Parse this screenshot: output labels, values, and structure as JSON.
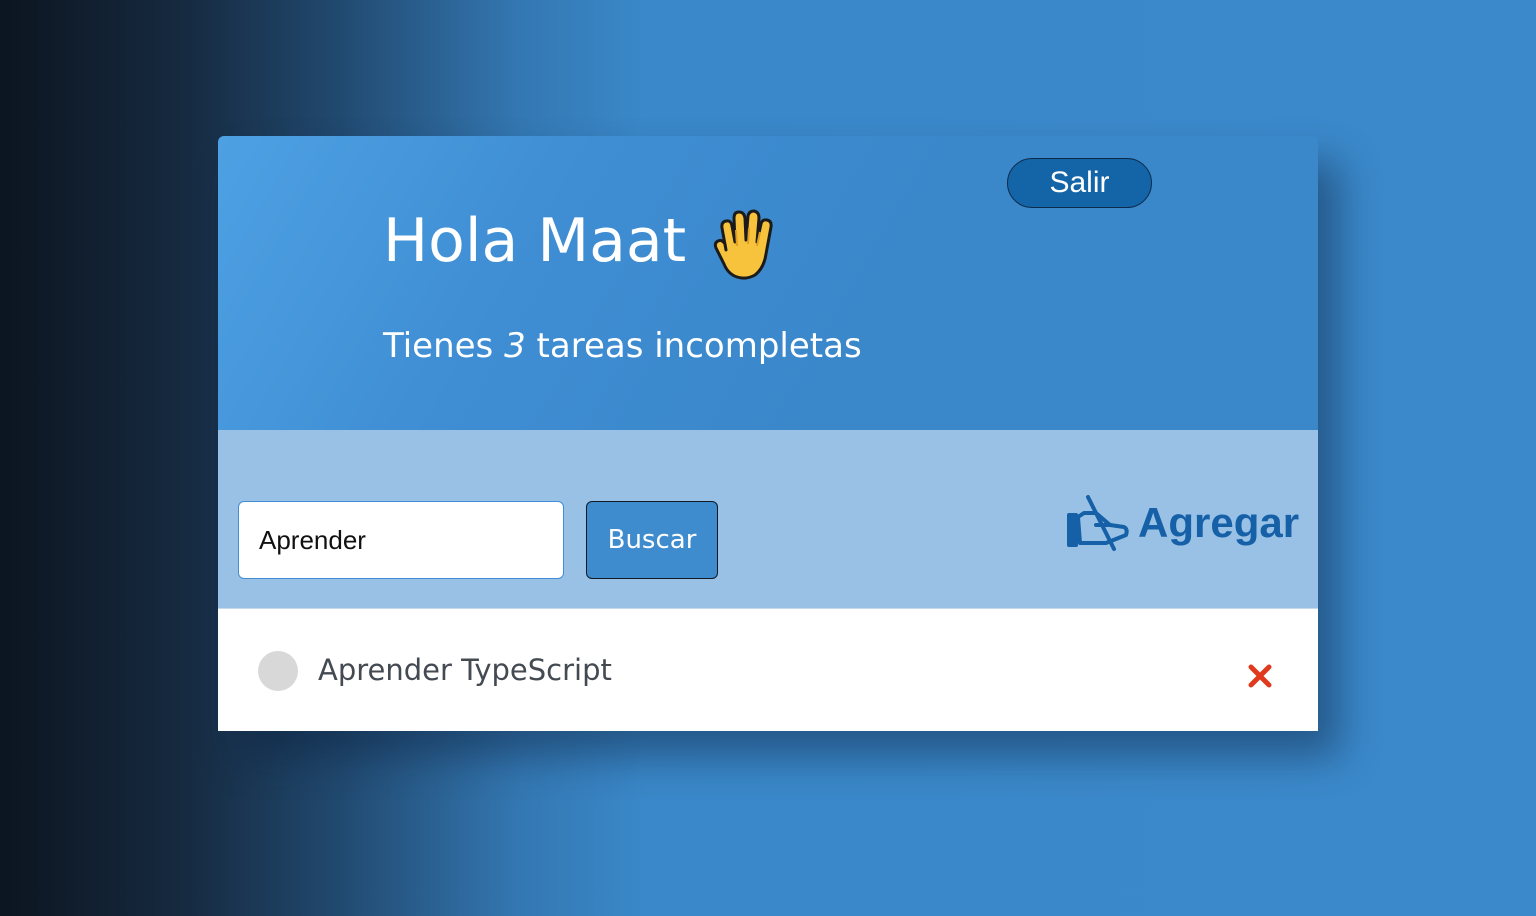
{
  "header": {
    "greeting": "Hola Maat",
    "hand_icon": "raised-hand-icon",
    "subtitle_prefix": "Tienes",
    "incomplete_count": "3",
    "subtitle_suffix": "tareas incompletas",
    "logout_label": "Salir"
  },
  "toolbar": {
    "search_value": "Aprender",
    "search_button_label": "Buscar",
    "add_label": "Agregar",
    "add_icon": "writing-hand-icon"
  },
  "tasks": [
    {
      "text": "Aprender TypeScript",
      "completed": false,
      "delete_icon": "close-icon"
    }
  ],
  "colors": {
    "header_bg": "#3a87ca",
    "toolbar_bg": "#98c1e5",
    "accent": "#1560a6",
    "delete": "#e03a1e",
    "checkbox": "#d8d8d8"
  }
}
